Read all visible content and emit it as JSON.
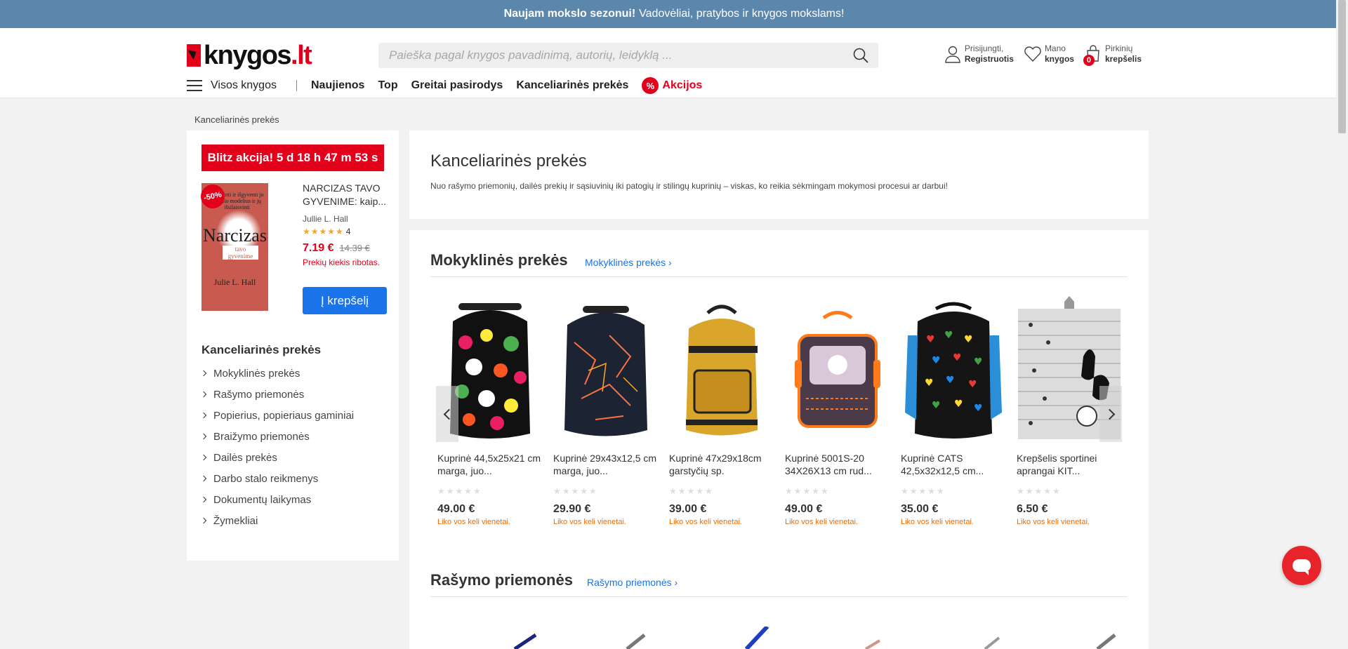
{
  "topbar": {
    "bold": "Naujam mokslo sezonui!",
    "text": "Vadovėliai, pratybos ir knygos mokslams!"
  },
  "header": {
    "logo": {
      "text": "knygos",
      "tld": ".lt"
    },
    "search_placeholder": "Paieška pagal knygos pavadinimą, autorių, leidyklą ...",
    "account": {
      "line1": "Prisijungti,",
      "line2": "Registruotis"
    },
    "wishlist": {
      "line1": "Mano",
      "line2": "knygos"
    },
    "cart": {
      "line1": "Pirkinių",
      "line2": "krepšelis",
      "count": "0"
    }
  },
  "nav": {
    "all_books": "Visos knygos",
    "items": [
      "Naujienos",
      "Top",
      "Greitai pasirodys",
      "Kanceliarinės prekės"
    ],
    "promo_icon": "%",
    "promo": "Akcijos"
  },
  "breadcrumb": "Kanceliarinės prekės",
  "blitz": {
    "label": "Blitz akcija! 5 d 18 h 47 m 53 s",
    "badge": "-50%",
    "cover": {
      "tagline": "Atpažinti ir išgyventi jo elgesio modelius ir jų išsilaisvinti",
      "title": "Narcizas",
      "subtitle": "tavo gyvenime",
      "author": "Julie L. Hall"
    },
    "title": "NARCIZAS TAVO GYVENIME: kaip...",
    "author": "Jullie L. Hall",
    "stars": "★★★★★",
    "rating_count": "4",
    "price": "7.19 €",
    "old_price": "14.39 €",
    "limited": "Prekių kiekis ribotas.",
    "button": "Į krepšelį"
  },
  "categories": {
    "title": "Kanceliarinės prekės",
    "items": [
      "Mokyklinės prekės",
      "Rašymo priemonės",
      "Popierius, popieriaus gaminiai",
      "Braižymo priemonės",
      "Dailės prekės",
      "Darbo stalo reikmenys",
      "Dokumentų laikymas",
      "Žymekliai"
    ]
  },
  "intro": {
    "title": "Kanceliarinės prekės",
    "text": "Nuo rašymo priemonių, dailės prekių ir sąsiuvinių iki patogių ir stilingų kuprinių – viskas, ko reikia sėkmingam mokymosi procesui ar darbui!"
  },
  "section1": {
    "title": "Mokyklinės prekės",
    "link": "Mokyklinės prekės ›",
    "products": [
      {
        "name": "Kuprinė 44,5x25x21 cm marga, juo...",
        "price": "49.00 €",
        "stock": "Liko vos keli vienetai.",
        "stars": "★★★★★"
      },
      {
        "name": "Kuprinė 29x43x12,5 cm marga, juo...",
        "price": "29.90 €",
        "stock": "Liko vos keli vienetai.",
        "stars": "★★★★★"
      },
      {
        "name": "Kuprinė 47x29x18cm garstyčių sp.",
        "price": "39.00 €",
        "stock": "Liko vos keli vienetai.",
        "stars": "★★★★★"
      },
      {
        "name": "Kuprinė 5001S-20 34X26X13 cm rud...",
        "price": "49.00 €",
        "stock": "Liko vos keli vienetai.",
        "stars": "★★★★★"
      },
      {
        "name": "Kuprinė CATS 42,5x32x12,5 cm...",
        "price": "35.00 €",
        "stock": "Liko vos keli vienetai.",
        "stars": "★★★★★"
      },
      {
        "name": "Krepšelis sportinei aprangai KIT...",
        "price": "6.50 €",
        "stock": "Liko vos keli vienetai.",
        "stars": "★★★★★"
      }
    ]
  },
  "section2": {
    "title": "Rašymo priemonės",
    "link": "Rašymo priemonės ›"
  },
  "colors": {
    "accent_red": "#e3001b",
    "topbar": "#5c87ad",
    "link_blue": "#1a73e8",
    "stock_orange": "#f06b00"
  }
}
